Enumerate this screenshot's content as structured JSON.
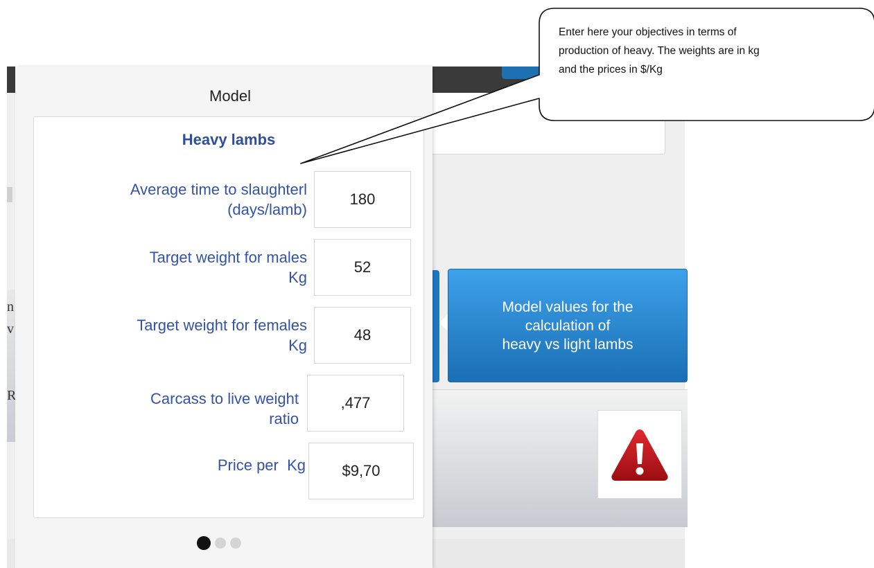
{
  "model": {
    "title": "Model",
    "card_title": "Heavy lambs",
    "fields": [
      {
        "label_line1": "Average time to slaughterl",
        "label_line2": "(days/lamb)",
        "value": "180"
      },
      {
        "label_line1": "Target weight for males",
        "label_line2": "Kg",
        "value": "52"
      },
      {
        "label_line1": "Target weight for females",
        "label_line2": "Kg",
        "value": "48"
      },
      {
        "label_line1": "Carcass to live weight",
        "label_line2": "ratio",
        "value": ",477"
      },
      {
        "label_line1": "Price per  Kg",
        "label_line2": "",
        "value": "$9,70"
      }
    ],
    "pagination": {
      "total": 3,
      "active": 1
    }
  },
  "tooltip": {
    "line1": "Model values for the",
    "line2": "calculation of",
    "line3": "heavy vs light lambs"
  },
  "callout": {
    "line1": "Enter here your objectives in terms of",
    "line2": "production of heavy. The weights are in kg",
    "line3": "and the prices in $/Kg"
  },
  "background": {
    "left_chars": [
      "n",
      "v",
      "R"
    ]
  },
  "colors": {
    "label_blue": "#3253a8",
    "title_blue": "#2e4f9e",
    "tooltip_blue": "#2a8ad6",
    "warning_red": "#c8141c"
  },
  "icons": {
    "warning": "warning-triangle-icon"
  }
}
